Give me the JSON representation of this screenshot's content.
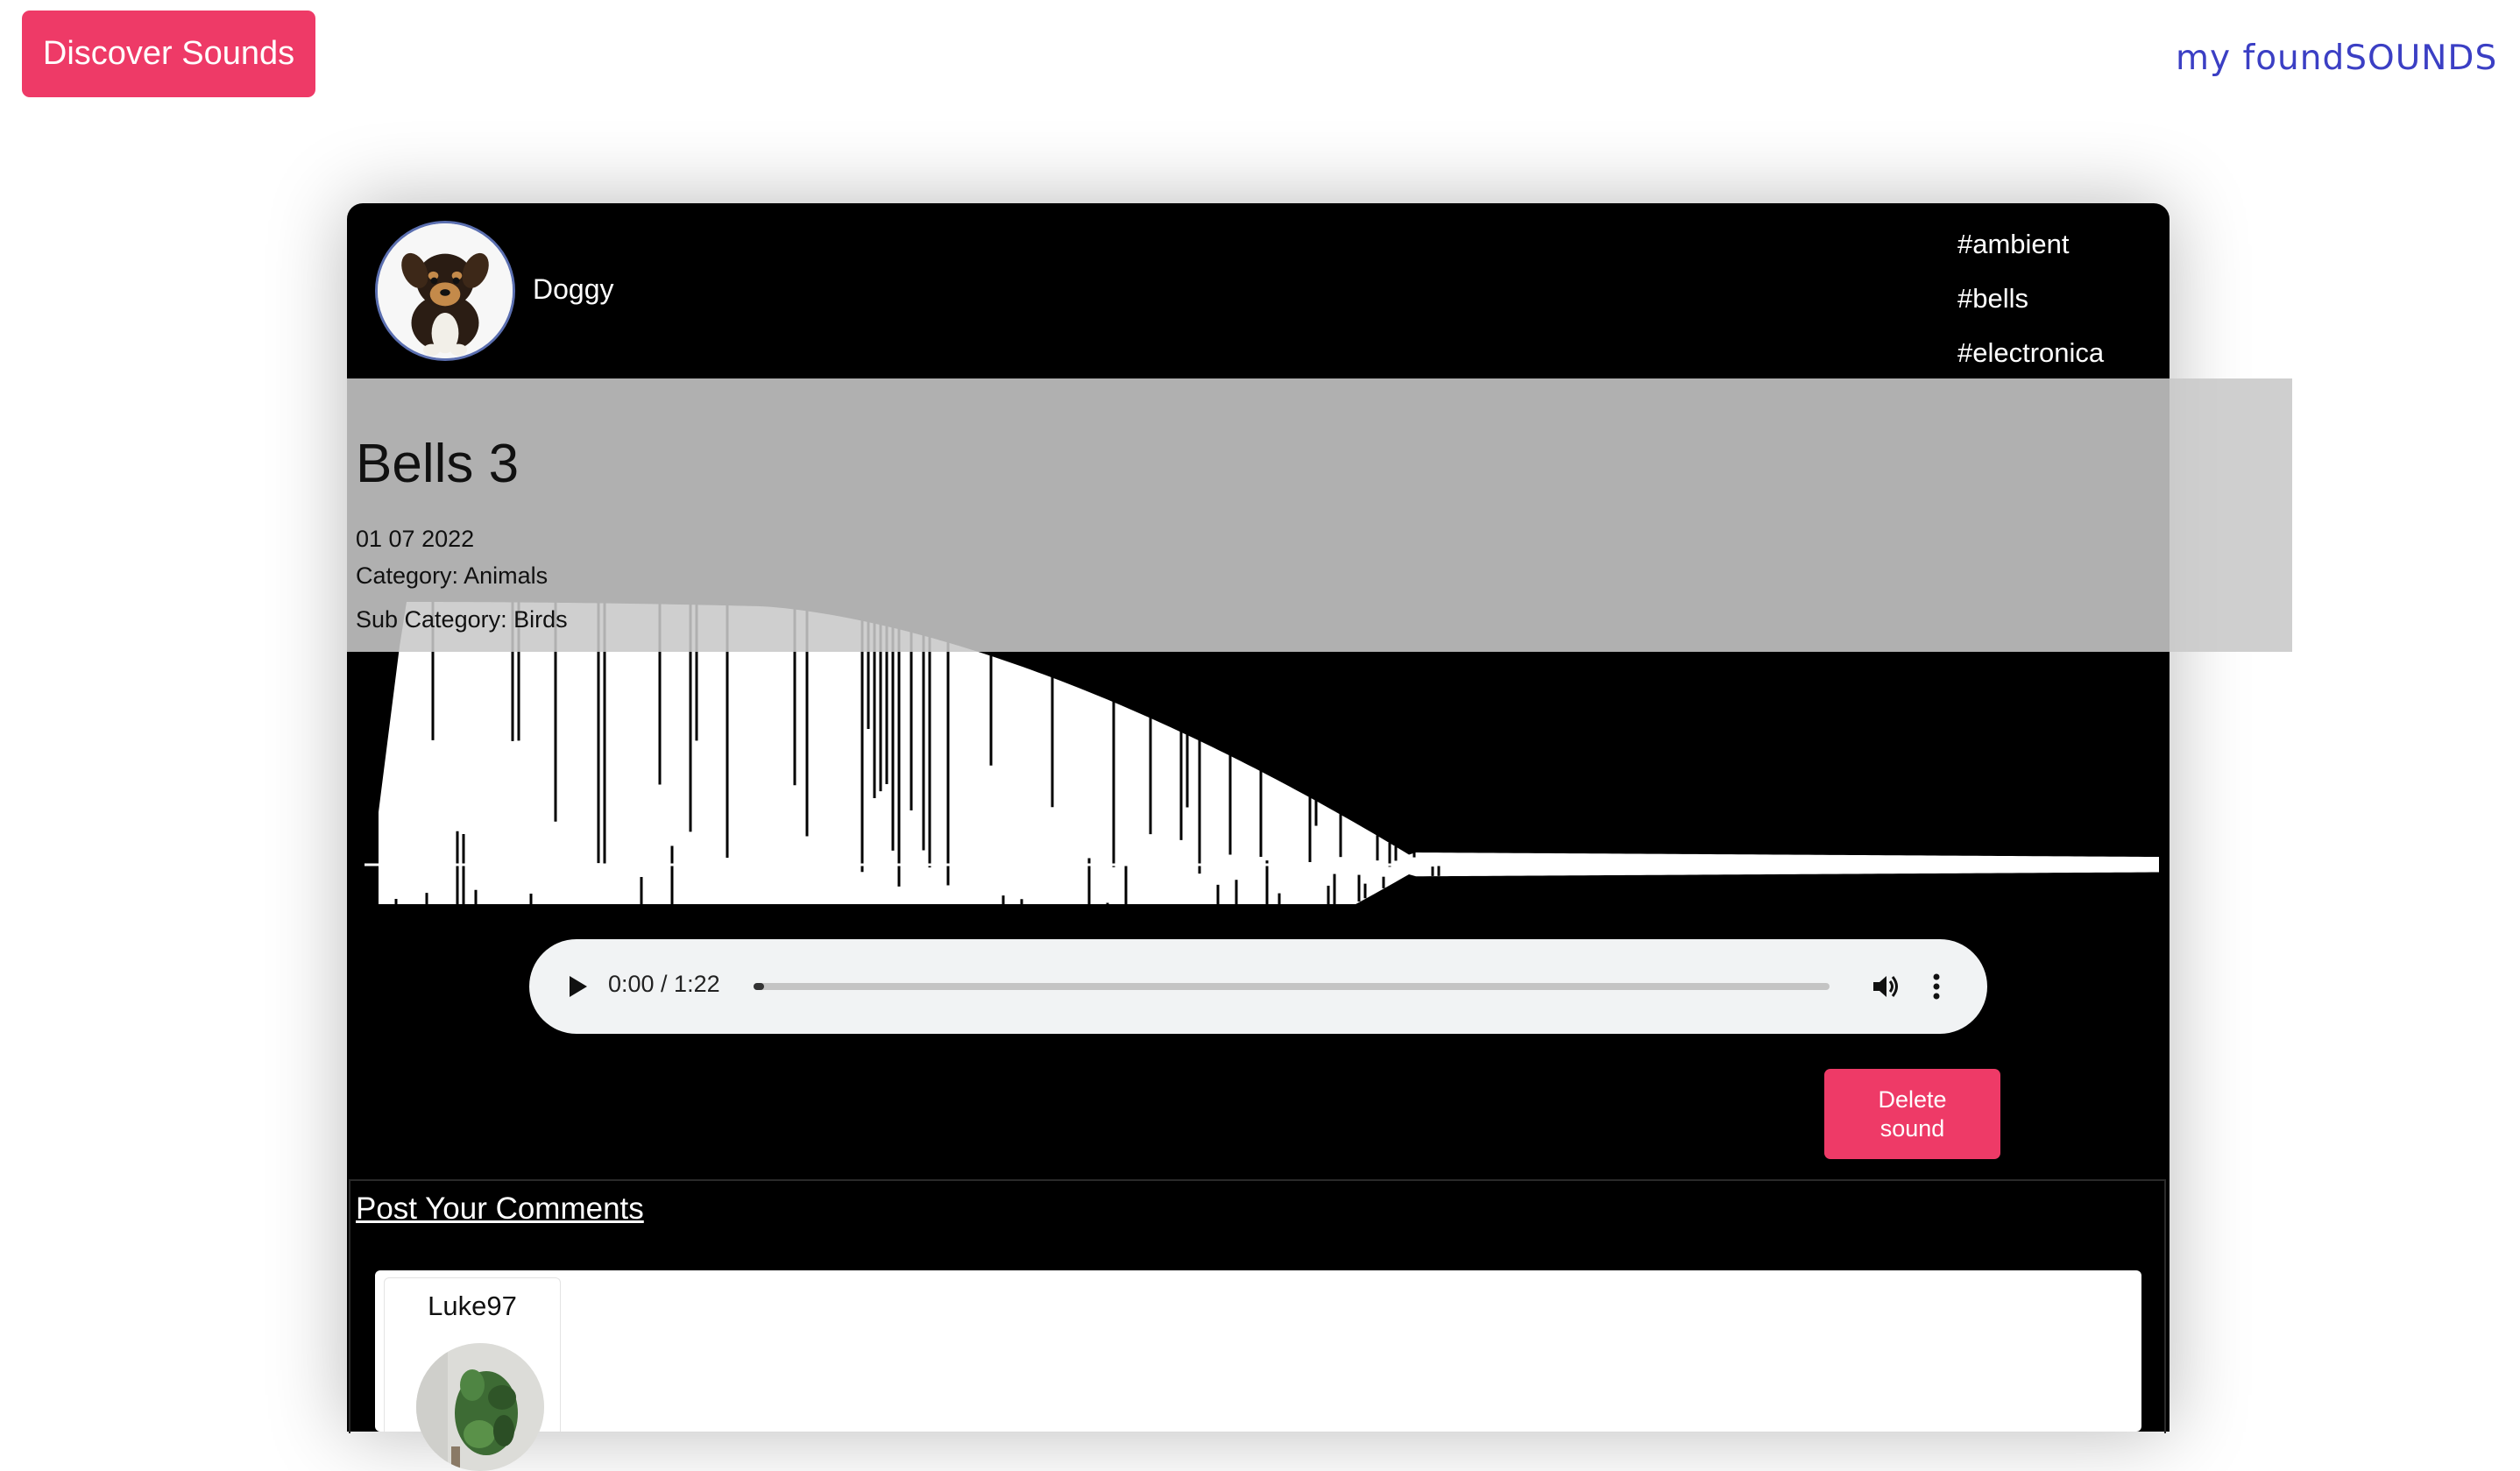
{
  "nav": {
    "discover_label": "Discover Sounds"
  },
  "logo": {
    "text_light": "my found",
    "text_strong": "SOUNDS",
    "icon": "soundwave-logo-icon"
  },
  "sound": {
    "uploader": "Doggy",
    "tags": [
      "#ambient",
      "#bells",
      "#electronica"
    ],
    "title": "Bells 3",
    "date": "01 07 2022",
    "category": "Category: Animals",
    "sub_category": "Sub Category: Birds"
  },
  "player": {
    "time": "0:00 / 1:22",
    "progress": 0
  },
  "actions": {
    "delete_label": "Delete sound"
  },
  "comments": {
    "post_label": "Post Your Comments",
    "items": [
      {
        "user": "Luke97"
      }
    ]
  },
  "colors": {
    "accent": "#ee3a67",
    "logo": "#3b3fc4",
    "card": "#000000"
  }
}
